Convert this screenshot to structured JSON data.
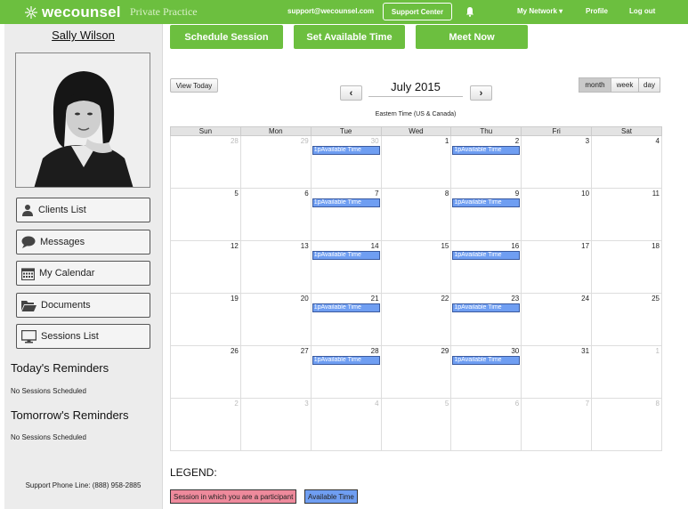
{
  "topbar": {
    "brand": "wecounsel",
    "practice": "Private Practice",
    "email": "support@wecounsel.com",
    "support_label": "Support Center",
    "nav": [
      "My Network",
      "Profile",
      "Log out"
    ],
    "network_caret": "▾"
  },
  "sidebar": {
    "user_name": "Sally Wilson",
    "buttons": [
      {
        "label": "Clients List",
        "icon": "user-icon"
      },
      {
        "label": "Messages",
        "icon": "chat-bubble-icon"
      },
      {
        "label": "My Calendar",
        "icon": "calendar-icon"
      },
      {
        "label": "Documents",
        "icon": "folder-icon"
      },
      {
        "label": "Sessions List",
        "icon": "monitor-icon"
      }
    ],
    "today_title": "Today's Reminders",
    "today_text": "No Sessions Scheduled",
    "tomorrow_title": "Tomorrow's Reminders",
    "tomorrow_text": "No Sessions Scheduled",
    "phone": "Support Phone Line: (888) 958-2885"
  },
  "actions": {
    "schedule": "Schedule Session",
    "available": "Set Available Time",
    "meet": "Meet Now"
  },
  "calendar": {
    "view_today": "View Today",
    "prev": "‹",
    "next": "›",
    "title": "July 2015",
    "timezone": "Eastern Time (US & Canada)",
    "views": [
      "month",
      "week",
      "day"
    ],
    "active_view": "month",
    "days": [
      "Sun",
      "Mon",
      "Tue",
      "Wed",
      "Thu",
      "Fri",
      "Sat"
    ],
    "weeks": [
      [
        {
          "d": "28",
          "o": true
        },
        {
          "d": "29",
          "o": true
        },
        {
          "d": "30",
          "o": true,
          "e": "1pAvailable Time"
        },
        {
          "d": "1"
        },
        {
          "d": "2",
          "e": "1pAvailable Time"
        },
        {
          "d": "3"
        },
        {
          "d": "4"
        }
      ],
      [
        {
          "d": "5"
        },
        {
          "d": "6"
        },
        {
          "d": "7",
          "e": "1pAvailable Time"
        },
        {
          "d": "8"
        },
        {
          "d": "9",
          "e": "1pAvailable Time"
        },
        {
          "d": "10"
        },
        {
          "d": "11"
        }
      ],
      [
        {
          "d": "12"
        },
        {
          "d": "13"
        },
        {
          "d": "14",
          "e": "1pAvailable Time"
        },
        {
          "d": "15"
        },
        {
          "d": "16",
          "e": "1pAvailable Time"
        },
        {
          "d": "17"
        },
        {
          "d": "18"
        }
      ],
      [
        {
          "d": "19"
        },
        {
          "d": "20"
        },
        {
          "d": "21",
          "e": "1pAvailable Time"
        },
        {
          "d": "22"
        },
        {
          "d": "23",
          "e": "1pAvailable Time"
        },
        {
          "d": "24"
        },
        {
          "d": "25"
        }
      ],
      [
        {
          "d": "26"
        },
        {
          "d": "27"
        },
        {
          "d": "28",
          "e": "1pAvailable Time"
        },
        {
          "d": "29"
        },
        {
          "d": "30",
          "e": "1pAvailable Time"
        },
        {
          "d": "31"
        },
        {
          "d": "1",
          "o": true
        }
      ],
      [
        {
          "d": "2",
          "o": true
        },
        {
          "d": "3",
          "o": true
        },
        {
          "d": "4",
          "o": true
        },
        {
          "d": "5",
          "o": true
        },
        {
          "d": "6",
          "o": true
        },
        {
          "d": "7",
          "o": true
        },
        {
          "d": "8",
          "o": true
        }
      ]
    ]
  },
  "legend": {
    "title": "LEGEND:",
    "participant": "Session in which you are a participant",
    "available": "Available Time"
  },
  "colors": {
    "brand_green": "#6cbf3f",
    "available_blue": "#6f9ef2",
    "participant_pink": "#ee8a9c"
  }
}
